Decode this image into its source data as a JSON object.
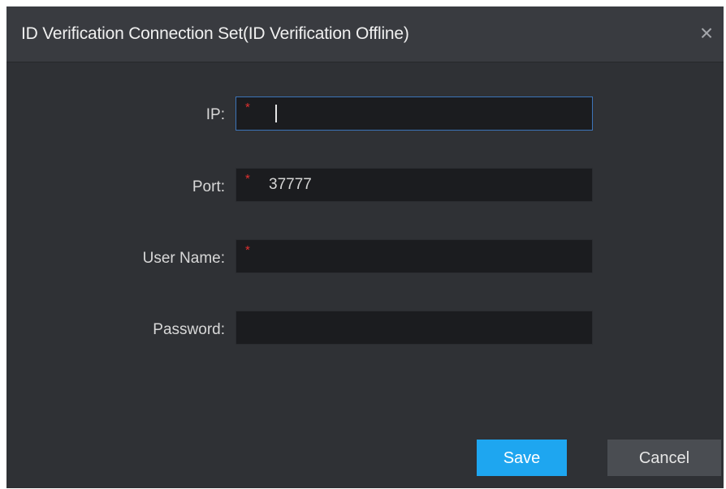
{
  "dialog": {
    "title": "ID Verification Connection Set(ID Verification Offline)",
    "close_glyph": "×"
  },
  "form": {
    "ip": {
      "label": "IP:",
      "value": "",
      "required": true
    },
    "port": {
      "label": "Port:",
      "value": "37777",
      "required": true
    },
    "user_name": {
      "label": "User Name:",
      "value": "",
      "required": true
    },
    "password": {
      "label": "Password:",
      "value": "",
      "required": false
    },
    "required_marker": "*"
  },
  "buttons": {
    "save": "Save",
    "cancel": "Cancel"
  },
  "colors": {
    "dialog_bg": "#2f3135",
    "titlebar_bg": "#393b40",
    "input_bg": "#1b1c1f",
    "focus_border": "#3c74b8",
    "required_marker": "#e0302f",
    "primary_button": "#1ea6f0",
    "secondary_button": "#4a4d52"
  }
}
